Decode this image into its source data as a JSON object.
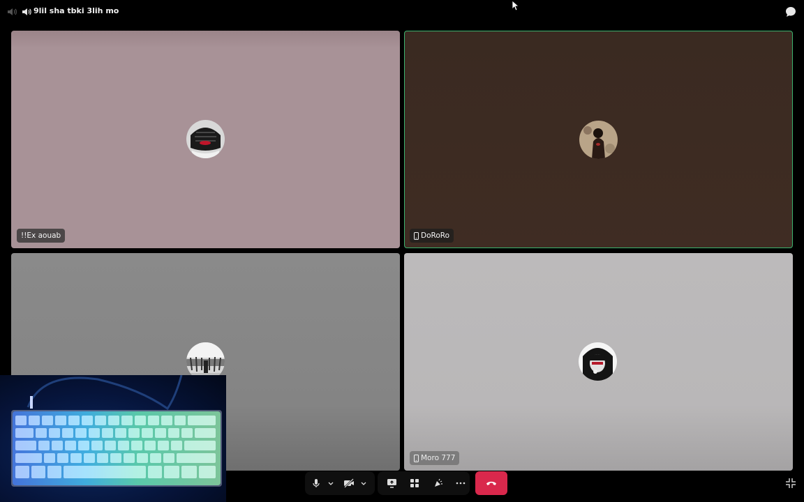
{
  "channel": {
    "name": "9lil sha tbki 3lih mo"
  },
  "participants": [
    {
      "name": "!!Ex aouab",
      "mobile": false
    },
    {
      "name": "DoRoRo",
      "mobile": true,
      "speaking": true
    },
    {
      "name": "",
      "mobile": false
    },
    {
      "name": "Moro 777",
      "mobile": true
    }
  ],
  "colors": {
    "speaking_border": "#3bb36e",
    "hangup": "#d9284c",
    "tile1_bg": "#a89297",
    "tile2_bg": "#3f2c23",
    "tile3_bg": "#848484",
    "tile4_bg": "#b9b7b8"
  },
  "controls": {
    "icons": [
      "microphone-icon",
      "chevron-down-icon",
      "camera-off-icon",
      "chevron-down-icon",
      "screen-share-icon",
      "activities-icon",
      "soundboard-icon",
      "more-icon",
      "hangup-icon"
    ]
  }
}
